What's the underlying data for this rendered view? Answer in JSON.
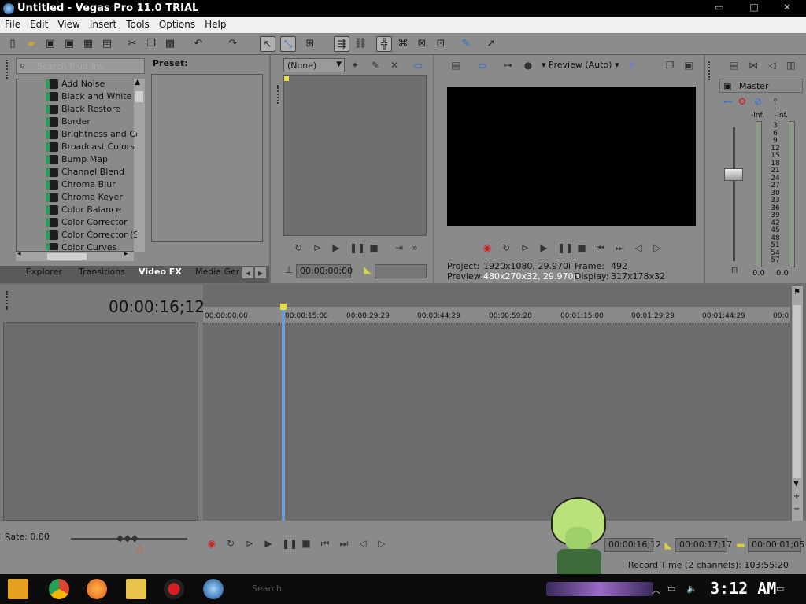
{
  "window": {
    "title": "Untitled - Vegas Pro 11.0 TRIAL",
    "controls": [
      "▭",
      "□",
      "✕"
    ]
  },
  "menu": [
    "File",
    "Edit",
    "View",
    "Insert",
    "Tools",
    "Options",
    "Help"
  ],
  "fx_panel": {
    "search_placeholder": "Search Plug-Ins",
    "preset_label": "Preset:",
    "items": [
      "Add Noise",
      "Black and White",
      "Black Restore",
      "Border",
      "Brightness and Co",
      "Broadcast Colors",
      "Bump Map",
      "Channel Blend",
      "Chroma Blur",
      "Chroma Keyer",
      "Color Balance",
      "Color Corrector",
      "Color Corrector (S",
      "Color Curves"
    ],
    "tabs": [
      "Explorer",
      "Transitions",
      "Video FX",
      "Media Gene"
    ],
    "active_tab": "Video FX"
  },
  "trimmer": {
    "dropdown": "(None)",
    "timecode": "00:00:00;00"
  },
  "preview": {
    "mode": "Preview (Auto)",
    "project_label": "Project:",
    "project_value": "1920x1080, 29.970i",
    "preview_label": "Preview:",
    "preview_value": "480x270x32, 29.970p",
    "frame_label": "Frame:",
    "frame_value": "492",
    "display_label": "Display:",
    "display_value": "317x178x32"
  },
  "master": {
    "label": "Master",
    "left_peak": "-Inf.",
    "right_peak": "-Inf.",
    "scale": [
      "3",
      "6",
      "9",
      "12",
      "15",
      "18",
      "21",
      "24",
      "27",
      "30",
      "33",
      "36",
      "39",
      "42",
      "45",
      "48",
      "51",
      "54",
      "57"
    ],
    "left_value": "0.0",
    "right_value": "0.0"
  },
  "timeline": {
    "current_time": "00:00:16;12",
    "ruler": [
      "00:00:00;00",
      "00:00:15:00",
      "00:00:29:29",
      "00:00:44:29",
      "00:00:59:28",
      "00:01:15:00",
      "00:01:29:29",
      "00:01:44:29",
      "00:0"
    ],
    "rate": "Rate: 0.00"
  },
  "transport": {
    "time1": "00:00:16;12",
    "time2": "00:00:17;17",
    "time3": "00:00:01;05",
    "record_time": "Record Time (2 channels): 103:55:20"
  },
  "taskbar": {
    "clock": "3:12 AM",
    "search_hint": "Search"
  },
  "colors": {
    "accent": "#2d6fd6",
    "playhead": "#6b9bd8",
    "record": "#d42020"
  }
}
